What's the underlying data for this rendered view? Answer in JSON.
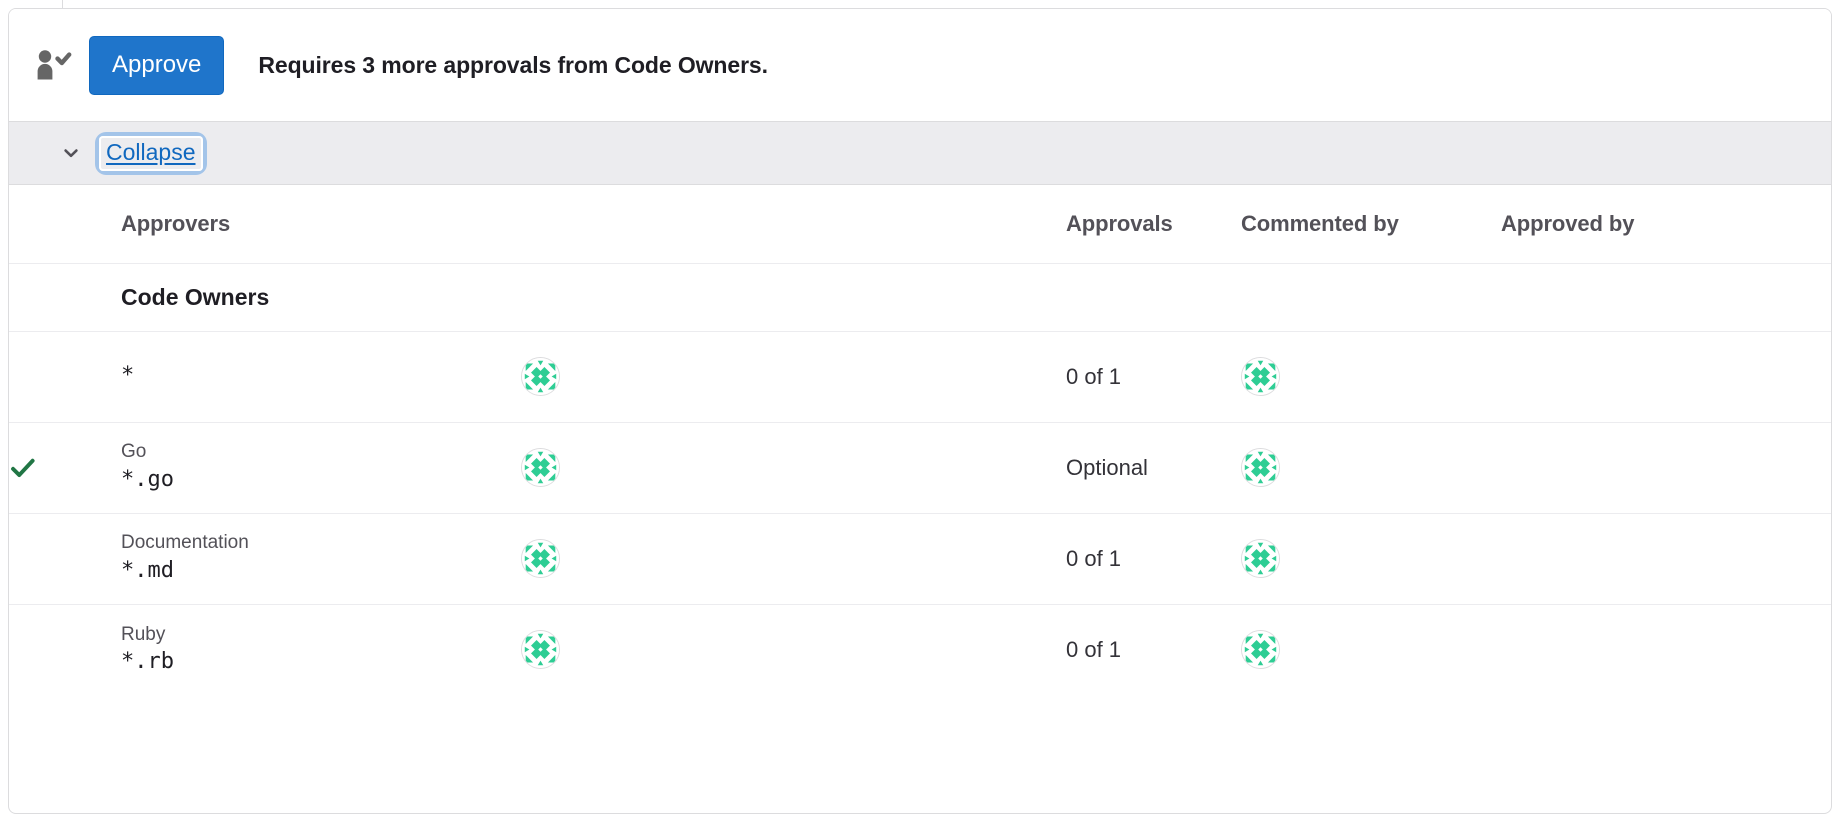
{
  "colors": {
    "primary_button_bg": "#1f75cb",
    "link": "#1068bf",
    "focus_ring": "#a3c4e9",
    "bar_bg": "#ececef",
    "border": "#dcdcde",
    "success_check": "#217645",
    "identicon_green": "#2ecd94",
    "text_dark": "#1f1e24",
    "text_muted": "#535158"
  },
  "action_bar": {
    "icon": "approval-person-check-icon",
    "approve_label": "Approve",
    "status_text": "Requires 3 more approvals from Code Owners."
  },
  "collapse_bar": {
    "chevron_icon": "chevron-down-icon",
    "collapse_label": "Collapse"
  },
  "table": {
    "headers": {
      "check": "",
      "approvers": "Approvers",
      "avatars": "",
      "approvals": "Approvals",
      "commented_by": "Commented by",
      "approved_by": "Approved by"
    },
    "section": {
      "label": "Code Owners"
    },
    "rows": [
      {
        "approved": false,
        "check_icon": "",
        "name": "",
        "pattern": "*",
        "eligible_avatars": [
          "identicon-avatar"
        ],
        "approvals": "0 of 1",
        "commented_by_avatars": [
          "identicon-avatar"
        ],
        "approved_by_avatars": []
      },
      {
        "approved": true,
        "check_icon": "check-icon",
        "name": "Go",
        "pattern": "*.go",
        "eligible_avatars": [
          "identicon-avatar"
        ],
        "approvals": "Optional",
        "commented_by_avatars": [
          "identicon-avatar"
        ],
        "approved_by_avatars": []
      },
      {
        "approved": false,
        "check_icon": "",
        "name": "Documentation",
        "pattern": "*.md",
        "eligible_avatars": [
          "identicon-avatar"
        ],
        "approvals": "0 of 1",
        "commented_by_avatars": [
          "identicon-avatar"
        ],
        "approved_by_avatars": []
      },
      {
        "approved": false,
        "check_icon": "",
        "name": "Ruby",
        "pattern": "*.rb",
        "eligible_avatars": [
          "identicon-avatar"
        ],
        "approvals": "0 of 1",
        "commented_by_avatars": [
          "identicon-avatar"
        ],
        "approved_by_avatars": []
      }
    ]
  }
}
